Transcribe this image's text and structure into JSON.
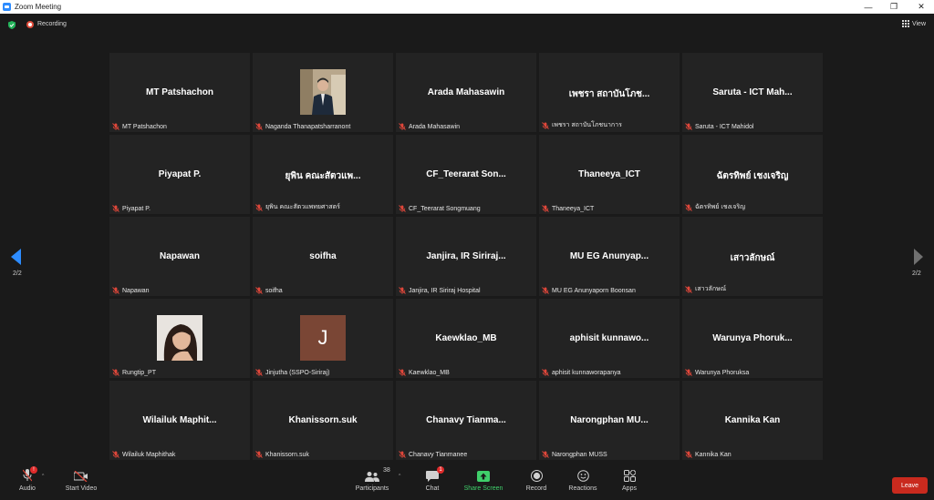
{
  "window": {
    "title": "Zoom Meeting",
    "controls": [
      "minimize",
      "restore",
      "close"
    ]
  },
  "topbar": {
    "recording_label": "Recording",
    "view_label": "View"
  },
  "pager": {
    "left_indicator": "2/2",
    "right_indicator": "2/2"
  },
  "tiles": [
    {
      "name": "MT Patshachon",
      "label": "MT Patshachon",
      "type": "name"
    },
    {
      "name": "",
      "label": "Naganda Thanapatsharranont",
      "type": "photo",
      "photo": "suited-man-icon"
    },
    {
      "name": "Arada Mahasawin",
      "label": "Arada Mahasawin",
      "type": "name"
    },
    {
      "name": "เพชรา สถาบันโภช...",
      "label": "เพชรา สถาบันโภชนาการ",
      "type": "name"
    },
    {
      "name": "Saruta - ICT Mah...",
      "label": "Saruta - ICT Mahidol",
      "type": "name"
    },
    {
      "name": "Piyapat P.",
      "label": "Piyapat P.",
      "type": "name"
    },
    {
      "name": "ยุพิน คณะสัตวแพ...",
      "label": "ยุพิน คณะสัตวแพทยศาสตร์",
      "type": "name"
    },
    {
      "name": "CF_Teerarat Son...",
      "label": "CF_Teerarat Songmuang",
      "type": "name"
    },
    {
      "name": "Thaneeya_ICT",
      "label": "Thaneeya_ICT",
      "type": "name"
    },
    {
      "name": "ฉัตรทิพย์ เชงเจริญ",
      "label": "ฉัตรทิพย์ เชงเจริญ",
      "type": "name"
    },
    {
      "name": "Napawan",
      "label": "Napawan",
      "type": "name"
    },
    {
      "name": "soifha",
      "label": "soifha",
      "type": "name"
    },
    {
      "name": "Janjira, IR Siriraj...",
      "label": "Janjira, IR Siriraj Hospital",
      "type": "name"
    },
    {
      "name": "MU EG Anunyap...",
      "label": "MU EG Anunyaporn Boonsan",
      "type": "name"
    },
    {
      "name": "เสาวลักษณ์",
      "label": "เสาวลักษณ์",
      "type": "name"
    },
    {
      "name": "",
      "label": "Rungtip_PT",
      "type": "photo",
      "photo": "woman-portrait-icon"
    },
    {
      "name": "J",
      "label": "Jinjutha (SSPO-Siriraj)",
      "type": "initial"
    },
    {
      "name": "Kaewklao_MB",
      "label": "Kaewklao_MB",
      "type": "name"
    },
    {
      "name": "aphisit kunnawo...",
      "label": "aphisit kunnaworapanya",
      "type": "name"
    },
    {
      "name": "Warunya Phoruk...",
      "label": "Warunya Phoruksa",
      "type": "name"
    },
    {
      "name": "Wilailuk Maphit...",
      "label": "Wilailuk Maphithak",
      "type": "name"
    },
    {
      "name": "Khanissorn.suk",
      "label": "Khanissorn.suk",
      "type": "name"
    },
    {
      "name": "Chanavy Tianma...",
      "label": "Chanavy Tianmanee",
      "type": "name"
    },
    {
      "name": "Narongphan MU...",
      "label": "Narongphan MUSS",
      "type": "name"
    },
    {
      "name": "Kannika Kan",
      "label": "Kannika Kan",
      "type": "name"
    }
  ],
  "toolbar": {
    "audio": {
      "label": "Audio",
      "badge": "!"
    },
    "video": {
      "label": "Start Video"
    },
    "participants": {
      "label": "Participants",
      "count": "38"
    },
    "chat": {
      "label": "Chat",
      "badge": "1"
    },
    "share": {
      "label": "Share Screen"
    },
    "record": {
      "label": "Record"
    },
    "reactions": {
      "label": "Reactions"
    },
    "apps": {
      "label": "Apps"
    },
    "leave": {
      "label": "Leave"
    }
  },
  "colors": {
    "share_green": "#3fcf6a",
    "leave_red": "#c92a1e",
    "mute_red": "#e0473a",
    "pager_blue": "#2d8cff"
  }
}
